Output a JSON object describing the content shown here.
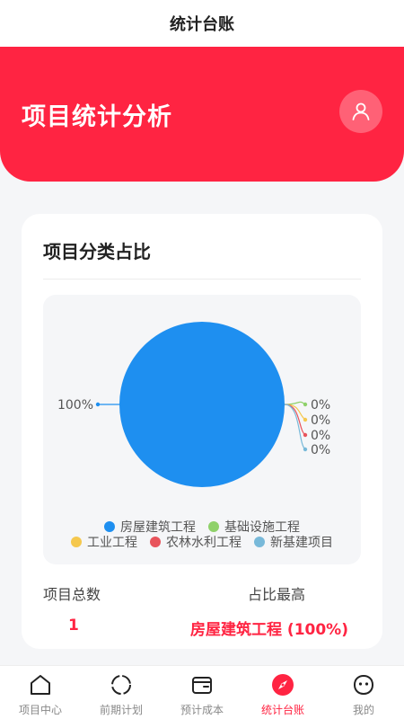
{
  "nav": {
    "title": "统计台账"
  },
  "header": {
    "title": "项目统计分析",
    "avatar_icon": "user-icon"
  },
  "card": {
    "title": "项目分类占比",
    "stats": {
      "total_label": "项目总数",
      "total_value": "1",
      "max_label": "占比最高",
      "max_value": "房屋建筑工程 (100%)"
    }
  },
  "chart_data": {
    "type": "pie",
    "categories": [
      "房屋建筑工程",
      "基础设施工程",
      "工业工程",
      "农林水利工程",
      "新基建项目"
    ],
    "values": [
      1,
      0,
      0,
      0,
      0
    ],
    "percent_labels": [
      "100%",
      "0%",
      "0%",
      "0%",
      "0%"
    ],
    "colors": [
      "#1e8ff0",
      "#8fd16a",
      "#f5c84e",
      "#e8545c",
      "#78b9d9"
    ],
    "legend_position": "bottom"
  },
  "tabs": [
    {
      "label": "项目中心",
      "icon": "home-icon",
      "active": false
    },
    {
      "label": "前期计划",
      "icon": "loading-circle-icon",
      "active": false
    },
    {
      "label": "预计成本",
      "icon": "wallet-icon",
      "active": false
    },
    {
      "label": "统计台账",
      "icon": "compass-icon",
      "active": true
    },
    {
      "label": "我的",
      "icon": "smiley-icon",
      "active": false
    }
  ],
  "colors": {
    "accent": "#ff2442",
    "text": "#222222",
    "muted": "#888888"
  }
}
